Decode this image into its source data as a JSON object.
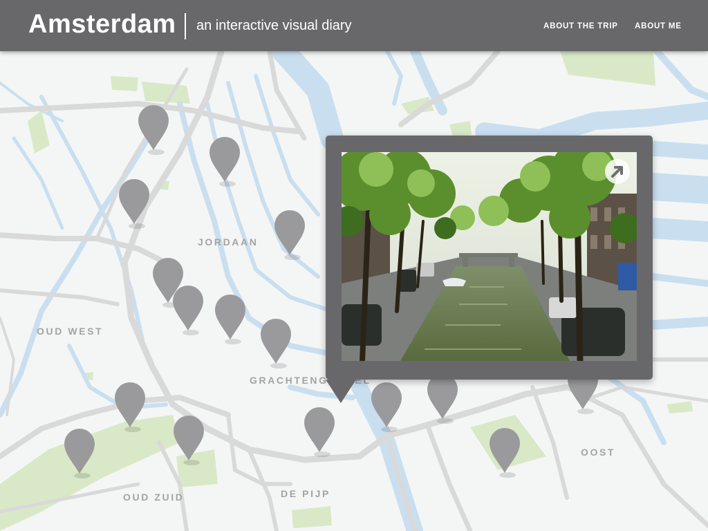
{
  "header": {
    "title": "Amsterdam",
    "tagline": "an interactive visual diary",
    "nav": [
      {
        "label": "ABOUT THE TRIP"
      },
      {
        "label": "ABOUT ME"
      }
    ]
  },
  "map": {
    "areas": [
      {
        "label": "JORDAAN"
      },
      {
        "label": "OUD WEST"
      },
      {
        "label": "GRACHTENGORDEL"
      },
      {
        "label": "OUD ZUID"
      },
      {
        "label": "DE PIJP"
      },
      {
        "label": "OOST"
      }
    ],
    "marker_icon": "map-pin-icon"
  },
  "popup": {
    "photo_subject": "tree-lined Amsterdam canal",
    "expand_icon": "expand-arrow-icon"
  },
  "colors": {
    "header": "#68686b",
    "map_background": "#f4f6f5",
    "water": "#c9dff0",
    "roads": "#d9d9d9",
    "parks": "#d9e9c7",
    "marker": "#9a9a9c",
    "area_label": "#a3a3a3"
  }
}
